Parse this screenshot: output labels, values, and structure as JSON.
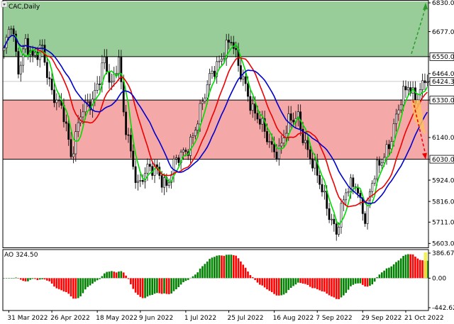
{
  "chart_data": [
    {
      "type": "candlestick",
      "title": "CAC,Daily",
      "x_tick_labels": [
        "31 Mar 2022",
        "26 Apr 2022",
        "18 May 2022",
        "9 Jun 2022",
        "1 Jul 2022",
        "25 Jul 2022",
        "16 Aug 2022",
        "7 Sep 2022",
        "29 Sep 2022",
        "21 Oct 2022"
      ],
      "y_tick_labels": [
        "6830.0",
        "6677.0",
        "6550.0",
        "6464.0",
        "6424.3",
        "6330.0",
        "6140.0",
        "6030.0",
        "5924.0",
        "5816.0",
        "5711.0",
        "5603.0"
      ],
      "ylim": [
        5590,
        6830
      ],
      "current_price": 6424.3,
      "zones": [
        {
          "name": "resistance",
          "from": 6550,
          "to": 6830,
          "color": "#98cc98"
        },
        {
          "name": "support",
          "from": 6030,
          "to": 6330,
          "color": "#f4a8a8"
        }
      ],
      "key_levels": [
        6550,
        6330,
        6030
      ],
      "price_keypoints": [
        [
          0,
          6560
        ],
        [
          3,
          6720
        ],
        [
          6,
          6500
        ],
        [
          9,
          6630
        ],
        [
          12,
          6520
        ],
        [
          16,
          6600
        ],
        [
          20,
          6380
        ],
        [
          25,
          6240
        ],
        [
          28,
          6050
        ],
        [
          32,
          6280
        ],
        [
          37,
          6300
        ],
        [
          42,
          6560
        ],
        [
          45,
          6400
        ],
        [
          48,
          6520
        ],
        [
          50,
          6250
        ],
        [
          53,
          6080
        ],
        [
          56,
          5900
        ],
        [
          60,
          5960
        ],
        [
          64,
          5990
        ],
        [
          68,
          5900
        ],
        [
          72,
          6010
        ],
        [
          76,
          6080
        ],
        [
          79,
          6160
        ],
        [
          83,
          6300
        ],
        [
          87,
          6480
        ],
        [
          92,
          6580
        ],
        [
          95,
          6620
        ],
        [
          98,
          6500
        ],
        [
          101,
          6420
        ],
        [
          104,
          6280
        ],
        [
          108,
          6180
        ],
        [
          112,
          6100
        ],
        [
          115,
          6080
        ],
        [
          119,
          6200
        ],
        [
          123,
          6250
        ],
        [
          127,
          6080
        ],
        [
          131,
          5930
        ],
        [
          135,
          5800
        ],
        [
          139,
          5670
        ],
        [
          143,
          5850
        ],
        [
          147,
          5920
        ],
        [
          151,
          5740
        ],
        [
          154,
          5900
        ],
        [
          157,
          6000
        ],
        [
          161,
          6120
        ],
        [
          165,
          6280
        ],
        [
          169,
          6400
        ],
        [
          172,
          6350
        ],
        [
          176,
          6430
        ]
      ],
      "series": [
        {
          "name": "",
          "color": "#00dd00",
          "period": 5
        },
        {
          "name": "",
          "color": "#ee0000",
          "period": 13
        },
        {
          "name": "",
          "color": "#0000cc",
          "period": 21
        }
      ],
      "forecast": [
        {
          "direction": "up",
          "from": 6550,
          "to": 6830,
          "color": "#2a9a2a",
          "style": "dashed"
        },
        {
          "direction": "down",
          "from": 6330,
          "to": 6030,
          "color": "#ee0000",
          "style": "dashed"
        }
      ]
    },
    {
      "type": "bar",
      "title": "AO 324.50",
      "y_tick_labels": [
        "386.67",
        "0.00",
        "-442.62"
      ],
      "ylim": [
        -442.62,
        386.67
      ],
      "color_up": "#008000",
      "color_down": "#ff0000",
      "highlight_color": "#f0f040"
    }
  ]
}
